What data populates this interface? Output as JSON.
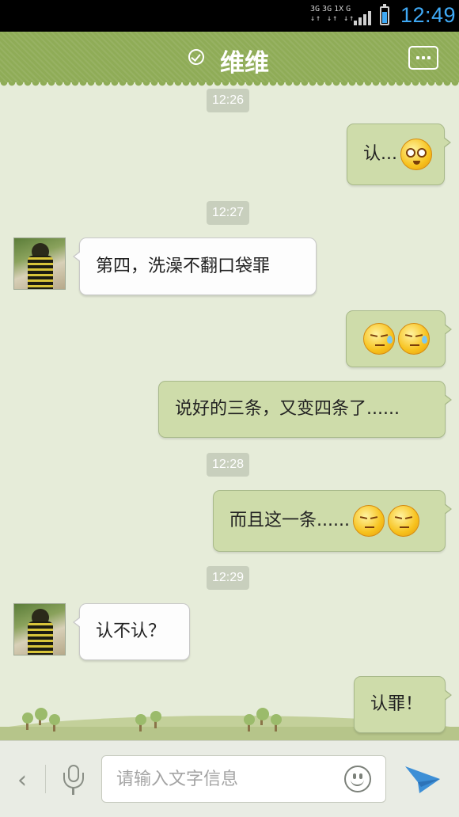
{
  "status_bar": {
    "network_labels": [
      "3G",
      "3G",
      "1X",
      "G"
    ],
    "time": "12:49",
    "battery_color": "#3fa9f5"
  },
  "header": {
    "title": "维维",
    "online_icon": "check-circle-icon",
    "menu_icon": "more-menu-icon",
    "background": "#8fac57"
  },
  "messages": [
    {
      "type": "timestamp",
      "text": "12:26"
    },
    {
      "type": "outgoing",
      "text": "认...",
      "emoji": [
        "pity-face"
      ]
    },
    {
      "type": "timestamp",
      "text": "12:27"
    },
    {
      "type": "incoming",
      "text": "第四，洗澡不翻口袋罪"
    },
    {
      "type": "outgoing",
      "text": "",
      "emoji": [
        "annoyed-sweat",
        "annoyed-sweat"
      ]
    },
    {
      "type": "outgoing",
      "text": "说好的三条，又变四条了......"
    },
    {
      "type": "timestamp",
      "text": "12:28"
    },
    {
      "type": "outgoing",
      "text": "而且这一条......",
      "emoji": [
        "annoyed",
        "annoyed"
      ]
    },
    {
      "type": "timestamp",
      "text": "12:29"
    },
    {
      "type": "incoming",
      "text": "认不认？"
    },
    {
      "type": "outgoing",
      "text": "认罪！"
    }
  ],
  "input_bar": {
    "placeholder": "请输入文字信息",
    "back_icon": "chevron-left-icon",
    "voice_icon": "microphone-icon",
    "emoji_icon": "smiley-icon",
    "send_icon": "send-arrow-icon"
  },
  "colors": {
    "chat_background": "#e6ecd9",
    "outgoing_bubble": "#cedcaa",
    "incoming_bubble": "#fdfdfd",
    "accent": "#3fa9f5"
  }
}
